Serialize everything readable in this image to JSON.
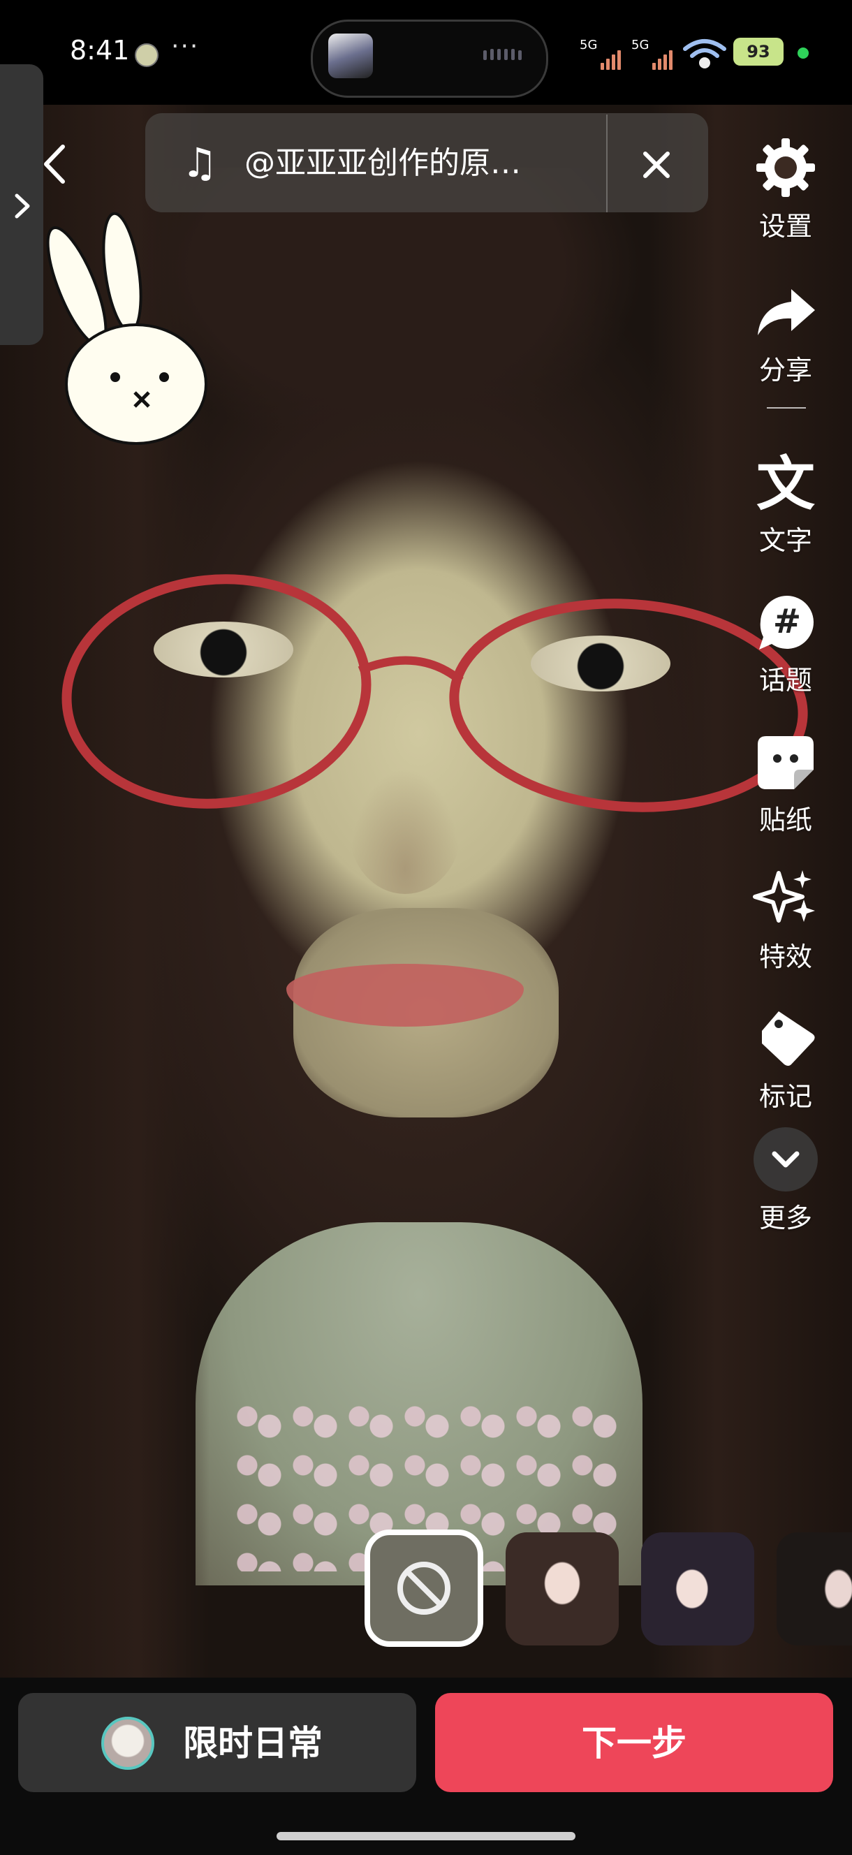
{
  "status_bar": {
    "time": "8:41",
    "dots": "···",
    "signal_1": "5G",
    "signal_2": "5G",
    "battery": "93"
  },
  "music": {
    "title": "@亚亚亚创作的原…",
    "icon": "music-note-icon"
  },
  "toolbar": {
    "items": [
      {
        "label": "设置",
        "icon": "gear-icon"
      },
      {
        "label": "分享",
        "icon": "share-arrow-icon"
      },
      {
        "label": "文字",
        "icon": "text-icon"
      },
      {
        "label": "话题",
        "icon": "hashtag-icon"
      },
      {
        "label": "贴纸",
        "icon": "sticker-icon"
      },
      {
        "label": "特效",
        "icon": "sparkle-icon"
      },
      {
        "label": "标记",
        "icon": "tag-icon"
      },
      {
        "label": "更多",
        "icon": "chevron-down-icon"
      }
    ]
  },
  "bottom": {
    "daily_label": "限时日常",
    "next_label": "下一步"
  },
  "colors": {
    "accent": "#ee4659",
    "panel": "#333333",
    "avatar_ring": "#58c7c0"
  }
}
